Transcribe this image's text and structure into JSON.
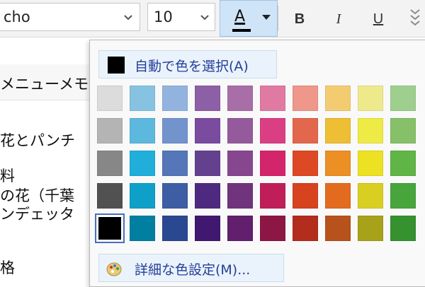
{
  "toolbar": {
    "font_name": "cho",
    "font_size": "10",
    "color_button_glyph": "A",
    "bold": "B",
    "italic": "I",
    "underline": "U"
  },
  "document": {
    "lines": [
      "メニューメモ",
      "花とパンチ",
      "料",
      "の花（千葉",
      "ンデェッタ",
      "格",
      ""
    ]
  },
  "color_menu": {
    "automatic_label": "自動で色を選択(A)",
    "more_colors_label": "詳細な色設定(M)...",
    "automatic_color": "#000000",
    "selected": "#000000",
    "rows": [
      [
        "#dcdcdc",
        "#86c3e0",
        "#93b3df",
        "#8d5fa6",
        "#a86ea7",
        "#e07aa3",
        "#ee978a",
        "#f3cc72",
        "#eeea8c",
        "#9fcf8e"
      ],
      [
        "#b4b4b4",
        "#5db8dd",
        "#7393cd",
        "#7a4b9f",
        "#955a9c",
        "#db3f83",
        "#e2674d",
        "#eebe34",
        "#eeea46",
        "#86c169"
      ],
      [
        "#878787",
        "#21aedb",
        "#5576b8",
        "#64418f",
        "#86478f",
        "#d3256b",
        "#dd4825",
        "#ec8f25",
        "#ece122",
        "#5fb546"
      ],
      [
        "#515151",
        "#0ea0c9",
        "#3e5da4",
        "#4d2a7f",
        "#70347d",
        "#bf1e59",
        "#d7421f",
        "#e36b1f",
        "#d9cf22",
        "#47a53c"
      ],
      [
        "#000000",
        "#007fa1",
        "#2a4791",
        "#41186f",
        "#611f6d",
        "#8c1745",
        "#b22d1c",
        "#b8521c",
        "#a8a11a",
        "#36912f"
      ]
    ]
  }
}
